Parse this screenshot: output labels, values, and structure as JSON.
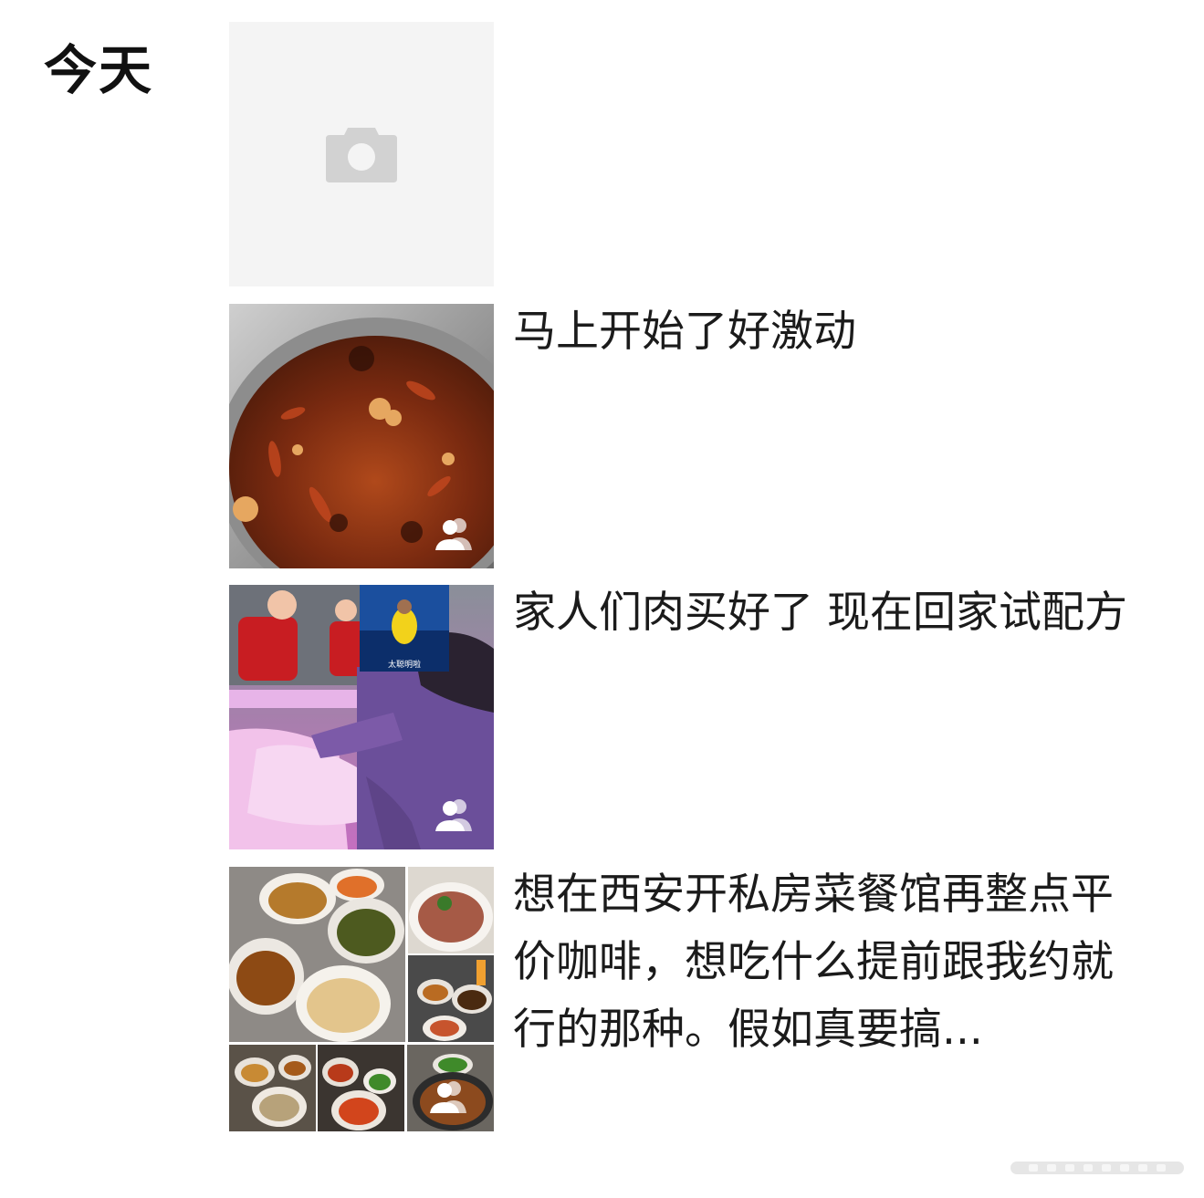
{
  "section": {
    "date_label": "今天"
  },
  "posts": [
    {
      "type": "placeholder",
      "icon": "camera-icon"
    },
    {
      "type": "photo",
      "caption": "马上开始了好激动",
      "icon": "multi-person-icon"
    },
    {
      "type": "photo",
      "caption": "家人们肉买好了 现在回家试配方",
      "inset_text": "太聪明啦",
      "icon": "multi-person-icon"
    },
    {
      "type": "collage",
      "caption": "想在西安开私房菜餐馆再整点平价咖啡，想吃什么提前跟我约就行的那种。假如真要搞...",
      "icon": "multi-person-icon"
    }
  ],
  "colors": {
    "placeholder_bg": "#f4f4f4",
    "icon_gray": "#d0d0d0"
  }
}
